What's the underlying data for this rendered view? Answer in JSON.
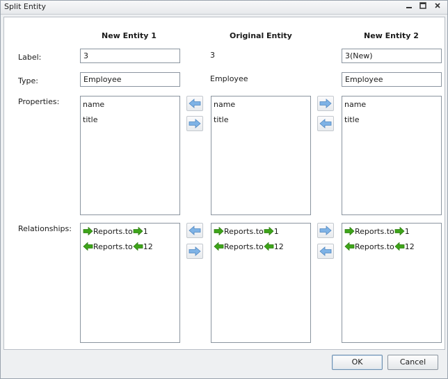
{
  "window": {
    "title": "Split Entity"
  },
  "columns": {
    "left": "New Entity 1",
    "middle": "Original Entity",
    "right": "New Entity 2"
  },
  "row_labels": {
    "label": "Label:",
    "type": "Type:",
    "properties": "Properties:",
    "relationships": "Relationships:"
  },
  "left": {
    "label": "3",
    "type": "Employee",
    "properties": [
      "name",
      "title"
    ],
    "relationships": [
      {
        "name": "Reports.to",
        "direction": "out",
        "target": "1"
      },
      {
        "name": "Reports.to",
        "direction": "in",
        "target": "12"
      }
    ]
  },
  "middle": {
    "label": "3",
    "type": "Employee",
    "properties": [
      "name",
      "title"
    ],
    "relationships": [
      {
        "name": "Reports.to",
        "direction": "out",
        "target": "1"
      },
      {
        "name": "Reports.to",
        "direction": "in",
        "target": "12"
      }
    ]
  },
  "right": {
    "label": "3(New)",
    "type": "Employee",
    "properties": [
      "name",
      "title"
    ],
    "relationships": [
      {
        "name": "Reports.to",
        "direction": "out",
        "target": "1"
      },
      {
        "name": "Reports.to",
        "direction": "in",
        "target": "12"
      }
    ]
  },
  "buttons": {
    "ok": "OK",
    "cancel": "Cancel"
  },
  "colors": {
    "relation_arrow": "#3ea51a",
    "move_arrow": "#7fb3e6"
  },
  "icons": {
    "minimize": "minimize-icon",
    "maximize": "maximize-icon",
    "close": "close-icon"
  }
}
